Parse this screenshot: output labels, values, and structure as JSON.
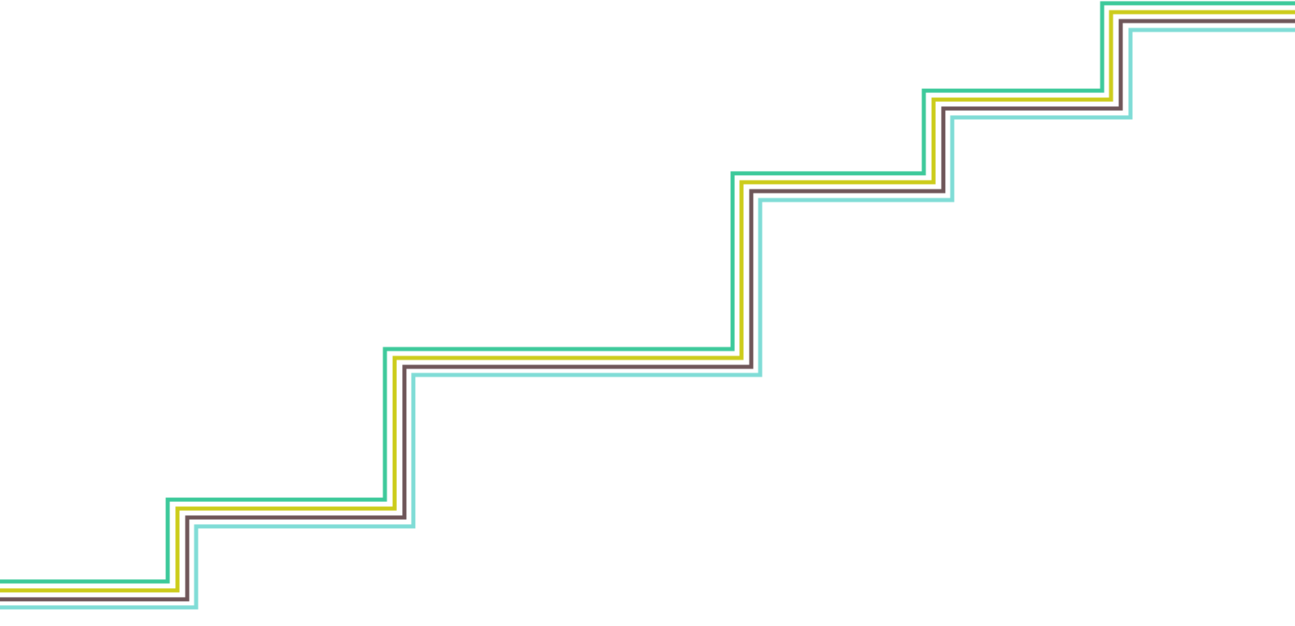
{
  "graphic": {
    "kind": "decorative-staircase-lines",
    "line_count": 4,
    "colors": [
      "#3cc99a",
      "#cccc1a",
      "#6e5558",
      "#7fdcd6"
    ]
  }
}
